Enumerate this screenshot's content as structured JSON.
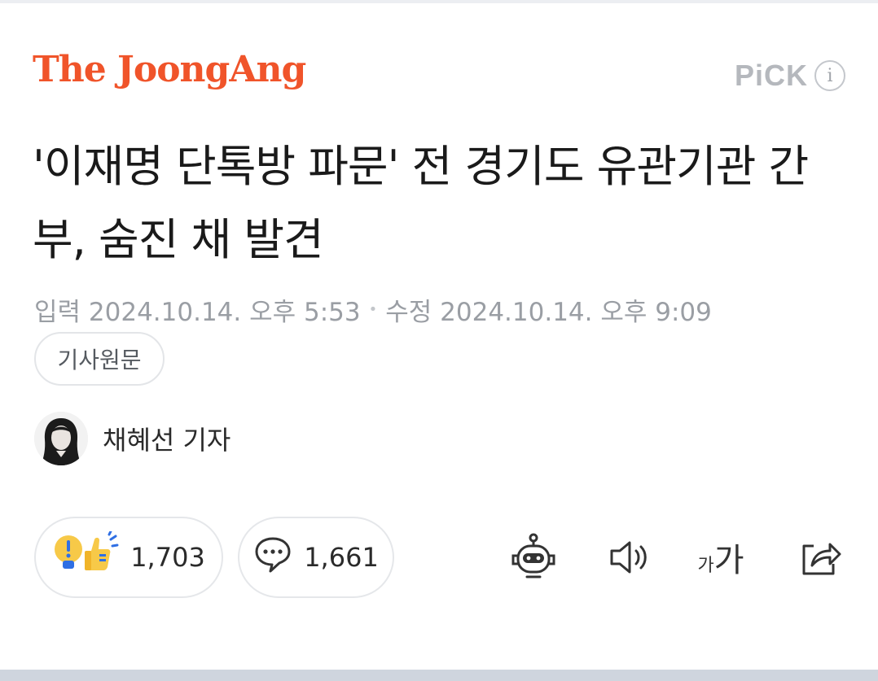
{
  "header": {
    "logo": "The JoongAng",
    "pick_label": "PiCK",
    "info_icon": "info-icon"
  },
  "article": {
    "headline": "'이재명 단톡방 파문' 전 경기도 유관기관 간부, 숨진 채 발견",
    "input_label": "입력",
    "input_datetime": "2024.10.14. 오후 5:53",
    "separator": "•",
    "edit_label": "수정",
    "edit_datetime": "2024.10.14. 오후 9:09",
    "original_button": "기사원문",
    "reporter": "채혜선 기자"
  },
  "actions": {
    "reaction_count": "1,703",
    "comment_count": "1,661",
    "font_size_small": "가",
    "font_size_large": "가"
  },
  "colors": {
    "brand": "#f0542a",
    "muted_text": "#9a9ea4",
    "reaction_yellow": "#f7c948",
    "reaction_blue": "#2f6fe4"
  },
  "icons": [
    "reaction-icon",
    "comment-icon",
    "summary-bot-icon",
    "speaker-icon",
    "font-size-icon",
    "share-icon"
  ]
}
